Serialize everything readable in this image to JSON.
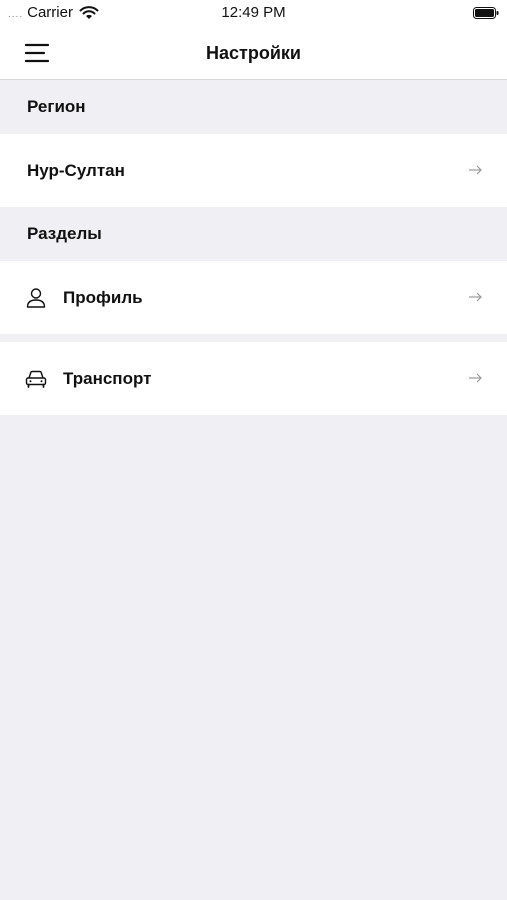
{
  "status_bar": {
    "signal": "....",
    "carrier": "Carrier",
    "time": "12:49 PM"
  },
  "nav": {
    "title": "Настройки",
    "menu_icon": "hamburger-menu-icon"
  },
  "sections": {
    "region": {
      "header": "Регион",
      "items": [
        {
          "label": "Нур-Султан",
          "icon": "arrow-right-icon"
        }
      ]
    },
    "parts": {
      "header": "Разделы",
      "items": [
        {
          "label": "Профиль",
          "icon": "user-icon"
        },
        {
          "label": "Транспорт",
          "icon": "car-icon"
        }
      ]
    }
  }
}
